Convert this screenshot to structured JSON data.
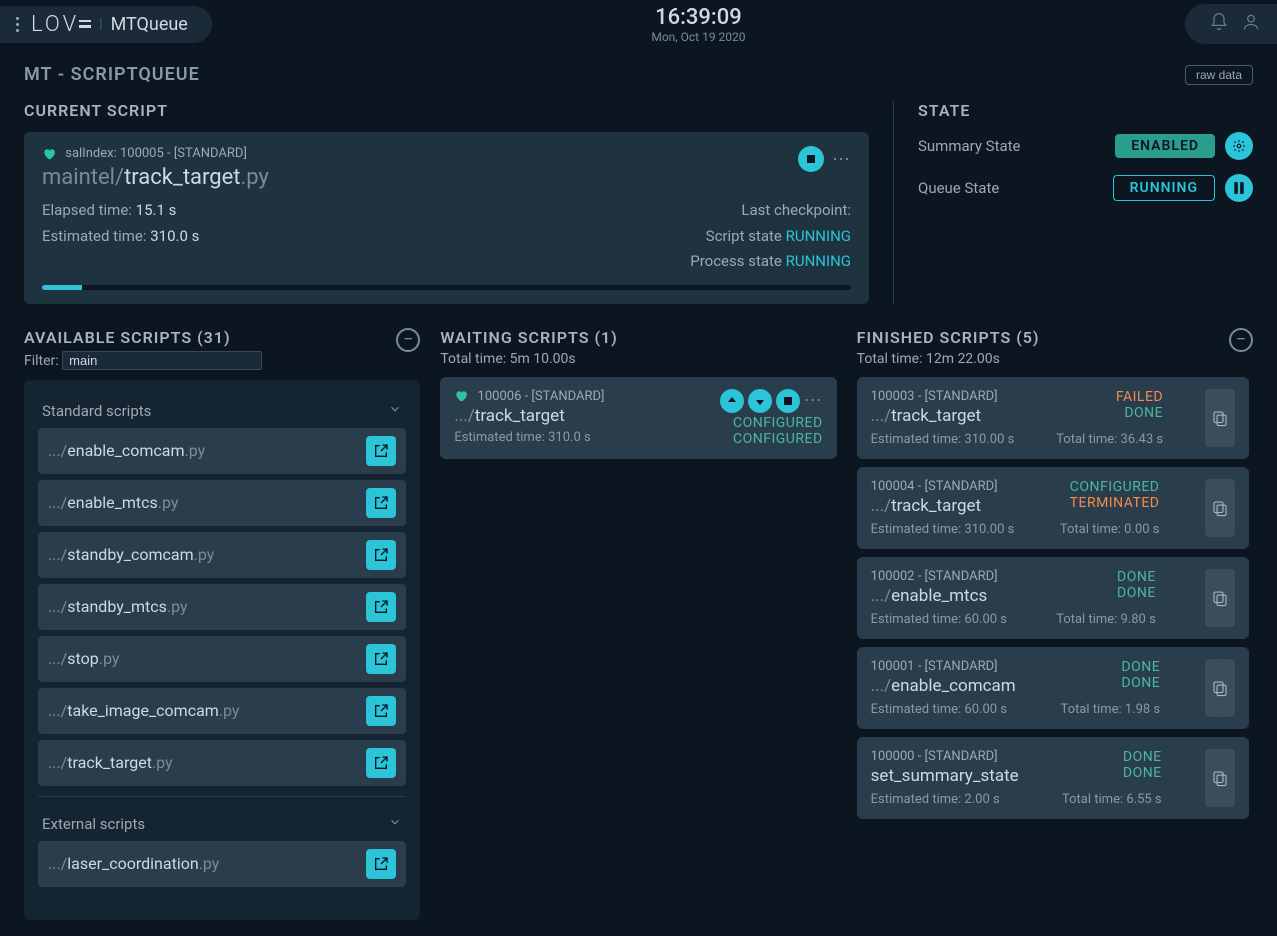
{
  "header": {
    "logo": "LOV",
    "logo_e": "E",
    "product": "MTQueue",
    "time": "16:39:09",
    "date": "Mon, Oct 19 2020"
  },
  "page": {
    "title": "MT - SCRIPTQUEUE",
    "raw_data": "raw data"
  },
  "current": {
    "title": "CURRENT SCRIPT",
    "sal_label": "salIndex:",
    "sal_index": "100005",
    "dash": "-",
    "type": "[STANDARD]",
    "path": "maintel/",
    "name": "track_target",
    "ext": ".py",
    "elapsed_label": "Elapsed time:",
    "elapsed": "15.1 s",
    "estimated_label": "Estimated time:",
    "estimated": "310.0 s",
    "checkpoint_label": "Last checkpoint:",
    "script_state_label": "Script state",
    "script_state": "RUNNING",
    "process_state_label": "Process state",
    "process_state": "RUNNING"
  },
  "state": {
    "title": "STATE",
    "summary_label": "Summary State",
    "summary": "ENABLED",
    "queue_label": "Queue State",
    "queue": "RUNNING"
  },
  "available": {
    "title": "AVAILABLE SCRIPTS (31)",
    "filter_label": "Filter:",
    "filter_value": "main",
    "group_standard": "Standard scripts",
    "group_external": "External scripts",
    "standard": [
      {
        "path": ".../",
        "name": "enable_comcam",
        "ext": ".py"
      },
      {
        "path": ".../",
        "name": "enable_mtcs",
        "ext": ".py"
      },
      {
        "path": ".../",
        "name": "standby_comcam",
        "ext": ".py"
      },
      {
        "path": ".../",
        "name": "standby_mtcs",
        "ext": ".py"
      },
      {
        "path": ".../",
        "name": "stop",
        "ext": ".py"
      },
      {
        "path": ".../",
        "name": "take_image_comcam",
        "ext": ".py"
      },
      {
        "path": ".../",
        "name": "track_target",
        "ext": ".py"
      }
    ],
    "external": [
      {
        "path": ".../",
        "name": "laser_coordination",
        "ext": ".py"
      }
    ]
  },
  "waiting": {
    "title": "WAITING SCRIPTS (1)",
    "total_label": "Total time:",
    "total": "5m 10.00s",
    "items": [
      {
        "index": "100006",
        "type": "[STANDARD]",
        "path": ".../",
        "name": "track_target",
        "est_label": "Estimated time:",
        "est": "310.0 s",
        "state1": "CONFIGURED",
        "state2": "CONFIGURED"
      }
    ]
  },
  "finished": {
    "title": "FINISHED SCRIPTS (5)",
    "total_label": "Total time:",
    "total": "12m 22.00s",
    "items": [
      {
        "index": "100003",
        "type": "[STANDARD]",
        "path": ".../",
        "name": "track_target",
        "est_label": "Estimated time:",
        "est": "310.00 s",
        "tot_label": "Total time:",
        "tot": "36.43 s",
        "s1": "FAILED",
        "s1c": "st-failed",
        "s2": "DONE",
        "s2c": "st-done"
      },
      {
        "index": "100004",
        "type": "[STANDARD]",
        "path": ".../",
        "name": "track_target",
        "est_label": "Estimated time:",
        "est": "310.00 s",
        "tot_label": "Total time:",
        "tot": "0.00 s",
        "s1": "CONFIGURED",
        "s1c": "st-configured",
        "s2": "TERMINATED",
        "s2c": "st-terminated"
      },
      {
        "index": "100002",
        "type": "[STANDARD]",
        "path": ".../",
        "name": "enable_mtcs",
        "est_label": "Estimated time:",
        "est": "60.00 s",
        "tot_label": "Total time:",
        "tot": "9.80 s",
        "s1": "DONE",
        "s1c": "st-done",
        "s2": "DONE",
        "s2c": "st-done"
      },
      {
        "index": "100001",
        "type": "[STANDARD]",
        "path": ".../",
        "name": "enable_comcam",
        "est_label": "Estimated time:",
        "est": "60.00 s",
        "tot_label": "Total time:",
        "tot": "1.98 s",
        "s1": "DONE",
        "s1c": "st-done",
        "s2": "DONE",
        "s2c": "st-done"
      },
      {
        "index": "100000",
        "type": "[STANDARD]",
        "path": "",
        "name": "set_summary_state",
        "est_label": "Estimated time:",
        "est": "2.00 s",
        "tot_label": "Total time:",
        "tot": "6.55 s",
        "s1": "DONE",
        "s1c": "st-done",
        "s2": "DONE",
        "s2c": "st-done"
      }
    ]
  }
}
